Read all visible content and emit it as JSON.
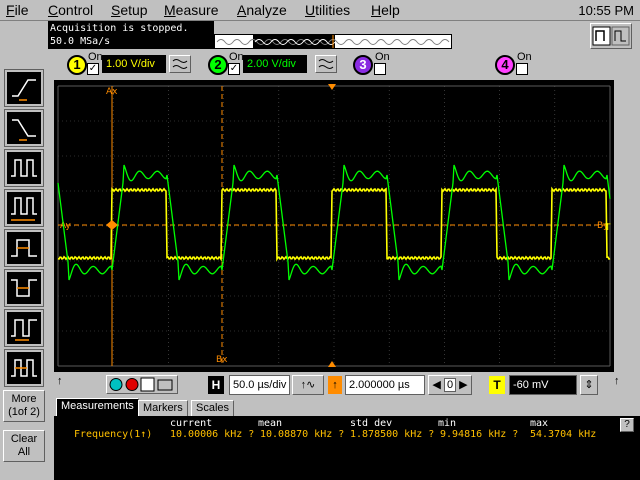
{
  "menu": {
    "items": [
      {
        "label": "File",
        "u": "F",
        "rest": "ile"
      },
      {
        "label": "Control",
        "u": "C",
        "rest": "ontrol"
      },
      {
        "label": "Setup",
        "u": "S",
        "rest": "etup"
      },
      {
        "label": "Measure",
        "u": "M",
        "rest": "easure"
      },
      {
        "label": "Analyze",
        "u": "A",
        "rest": "nalyze"
      },
      {
        "label": "Utilities",
        "u": "U",
        "rest": "tilities"
      },
      {
        "label": "Help",
        "u": "H",
        "rest": "elp"
      }
    ],
    "clock": "10:55 PM"
  },
  "status": {
    "line1": "Acquisition is stopped.",
    "line2": "50.0 MSa/s"
  },
  "channels": [
    {
      "number": "1",
      "on_label": "On",
      "checked": true,
      "scale": "1.00 V/div",
      "color": "#ffff00"
    },
    {
      "number": "2",
      "on_label": "On",
      "checked": true,
      "scale": "2.00 V/div",
      "color": "#00ff00"
    },
    {
      "number": "3",
      "on_label": "On",
      "checked": false,
      "color": "#a040ff"
    },
    {
      "number": "4",
      "on_label": "On",
      "checked": false,
      "color": "#ff40ff"
    }
  ],
  "side": {
    "more_label_1": "More",
    "more_label_2": "(1of 2)",
    "clear_label_1": "Clear",
    "clear_label_2": "All"
  },
  "screen": {
    "cursor_ax": "Ax",
    "cursor_bx": "Bx",
    "cursor_ay": "Ay",
    "cursor_by": "By",
    "trigger_marker": "T",
    "colors": {
      "grid": "#5a5a5a",
      "ch1": "#ffff00",
      "ch2": "#00ff00",
      "cursor": "#ff8c00"
    }
  },
  "horizontal": {
    "h_label": "H",
    "timebase": "50.0 µs/div",
    "delay_marker": "↑",
    "delay": "2.000000 µs",
    "zero": "0",
    "t_label": "T",
    "trigger_level": "-60 mV"
  },
  "tabs": [
    {
      "label": "Measurements",
      "active": true
    },
    {
      "label": "Markers",
      "active": false
    },
    {
      "label": "Scales",
      "active": false
    }
  ],
  "measurements": {
    "headers": {
      "current": "current",
      "mean": "mean",
      "std_dev": "std dev",
      "min": "min",
      "max": "max"
    },
    "rows": [
      {
        "name": "Frequency(1↑)",
        "current": "10.00006 kHz ?",
        "mean": "10.08870 kHz ?",
        "std_dev": "1.878500 kHz ?",
        "min": "9.94816 kHz ?",
        "max": "54.3704 kHz"
      }
    ]
  }
}
